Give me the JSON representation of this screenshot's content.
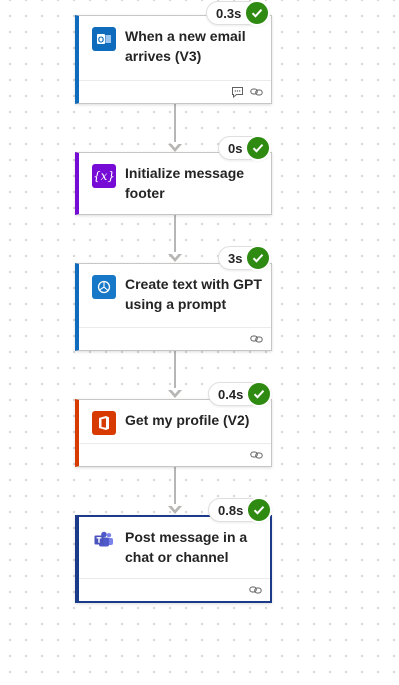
{
  "flow": {
    "steps": [
      {
        "title": "When a new email arrives (V3)",
        "duration": "0.3s",
        "status": "succeeded",
        "accent": "#0f6cbd",
        "icon": "outlook-icon",
        "footer_icons": [
          "comment-icon",
          "link-icon"
        ]
      },
      {
        "title": "Initialize message footer",
        "duration": "0s",
        "status": "succeeded",
        "accent": "#770bd6",
        "icon": "variable-icon",
        "footer_icons": []
      },
      {
        "title": "Create text with GPT using a prompt",
        "duration": "3s",
        "status": "succeeded",
        "accent": "#0f6cbd",
        "icon": "ai-builder-icon",
        "footer_icons": [
          "link-icon"
        ]
      },
      {
        "title": "Get my profile (V2)",
        "duration": "0.4s",
        "status": "succeeded",
        "accent": "#d83b01",
        "icon": "office365-icon",
        "footer_icons": [
          "link-icon"
        ]
      },
      {
        "title": "Post message in a chat or channel",
        "duration": "0.8s",
        "status": "succeeded",
        "accent": "#1b3a8a",
        "icon": "teams-icon",
        "footer_icons": [
          "link-icon"
        ],
        "selected": true
      }
    ]
  },
  "colors": {
    "success": "#2f8a12",
    "connector": "#b8b6b4"
  }
}
